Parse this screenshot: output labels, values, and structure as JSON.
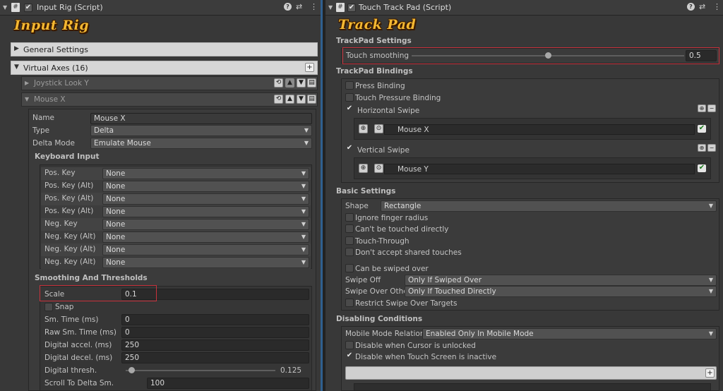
{
  "left": {
    "title": "Input Rig (Script)",
    "logo": "Input Rig",
    "general_settings": "General Settings",
    "virtual_axes": "Virtual Axes (16)",
    "joystick": "Joystick Look Y",
    "mouse": "Mouse X",
    "props": {
      "name_label": "Name",
      "name_value": "Mouse X",
      "type_label": "Type",
      "type_value": "Delta",
      "delta_label": "Delta Mode",
      "delta_value": "Emulate Mouse"
    },
    "keyboard_title": "Keyboard Input",
    "keys": [
      {
        "label": "Pos. Key",
        "value": "None"
      },
      {
        "label": "Pos. Key (Alt)",
        "value": "None"
      },
      {
        "label": "Pos. Key (Alt)",
        "value": "None"
      },
      {
        "label": "Pos. Key (Alt)",
        "value": "None"
      },
      {
        "label": "Neg. Key",
        "value": "None"
      },
      {
        "label": "Neg. Key (Alt)",
        "value": "None"
      },
      {
        "label": "Neg. Key (Alt)",
        "value": "None"
      },
      {
        "label": "Neg. Key (Alt)",
        "value": "None"
      }
    ],
    "smoothing_title": "Smoothing And Thresholds",
    "scale_label": "Scale",
    "scale_value": "0.1",
    "snap_label": "Snap",
    "fields": [
      {
        "label": "Sm. Time (ms)",
        "value": "0"
      },
      {
        "label": "Raw Sm. Time (ms)",
        "value": "0"
      },
      {
        "label": "Digital accel. (ms)",
        "value": "250"
      },
      {
        "label": "Digital decel. (ms)",
        "value": "250"
      }
    ],
    "thresh_label": "Digital thresh.",
    "thresh_value": "0.125",
    "scroll_label": "Scroll To Delta Sm.",
    "scroll_value": "100"
  },
  "right": {
    "title": "Touch Track Pad (Script)",
    "logo": "Track Pad",
    "settings_title": "TrackPad Settings",
    "smoothing_label": "Touch smoothing",
    "smoothing_value": "0.5",
    "bindings_title": "TrackPad Bindings",
    "press": "Press Binding",
    "pressure": "Touch Pressure Binding",
    "hswipe": "Horizontal Swipe",
    "hswipe_axis": "Mouse X",
    "vswipe": "Vertical Swipe",
    "vswipe_axis": "Mouse Y",
    "basic_title": "Basic Settings",
    "shape_label": "Shape",
    "shape_value": "Rectangle",
    "ignore": "Ignore finger radius",
    "cant_touch": "Can't be touched directly",
    "through": "Touch-Through",
    "dont_accept": "Don't accept shared touches",
    "swiped_over": "Can be swiped over",
    "swipe_off_label": "Swipe Off",
    "swipe_off_value": "Only If Swiped Over",
    "swipe_other_label": "Swipe Over Other",
    "swipe_other_value": "Only If Touched Directly",
    "restrict": "Restrict Swipe Over Targets",
    "disabling_title": "Disabling Conditions",
    "mobile_label": "Mobile Mode Relation",
    "mobile_value": "Enabled Only In Mobile Mode",
    "cursor": "Disable when Cursor is unlocked",
    "touchscreen": "Disable when Touch Screen is inactive"
  },
  "slider_levels": {
    "digital_thresh": 0.125,
    "touch_smoothing": 0.5
  },
  "colors": {
    "highlight": "#c8323c",
    "logo": "#f4b832",
    "divider": "#2f5f8f"
  }
}
